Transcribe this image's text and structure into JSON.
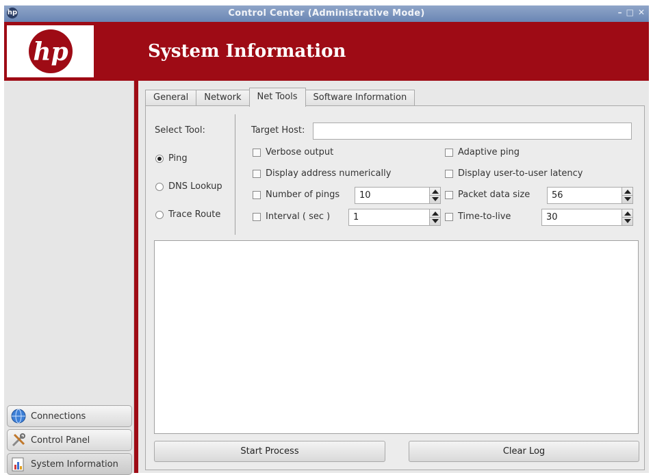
{
  "window": {
    "title": "Control Center (Administrative Mode)",
    "buttons": [
      "–",
      "□",
      "✕"
    ]
  },
  "header": {
    "title": "System Information",
    "brand_color": "#9e0b15"
  },
  "sidebar": {
    "items": [
      {
        "label": "Connections",
        "icon": "globe-icon"
      },
      {
        "label": "Control Panel",
        "icon": "tools-icon"
      },
      {
        "label": "System Information",
        "icon": "chart-icon",
        "active": true
      }
    ]
  },
  "tabs": [
    {
      "label": "General"
    },
    {
      "label": "Network"
    },
    {
      "label": "Net Tools",
      "active": true
    },
    {
      "label": "Software Information"
    }
  ],
  "net_tools": {
    "select_tool_label": "Select Tool:",
    "tools": [
      {
        "label": "Ping",
        "selected": true
      },
      {
        "label": "DNS Lookup",
        "selected": false
      },
      {
        "label": "Trace Route",
        "selected": false
      }
    ],
    "target_host_label": "Target Host:",
    "target_host_value": "",
    "options": {
      "verbose": "Verbose output",
      "adaptive": "Adaptive ping",
      "numeric": "Display address numerically",
      "latency": "Display user-to-user latency",
      "num_pings": {
        "label": "Number of pings",
        "value": "10"
      },
      "packet_size": {
        "label": "Packet data size",
        "value": "56"
      },
      "interval": {
        "label": "Interval ( sec )",
        "value": "1"
      },
      "ttl": {
        "label": "Time-to-live",
        "value": "30"
      }
    },
    "start_label": "Start Process",
    "clear_label": "Clear Log"
  }
}
